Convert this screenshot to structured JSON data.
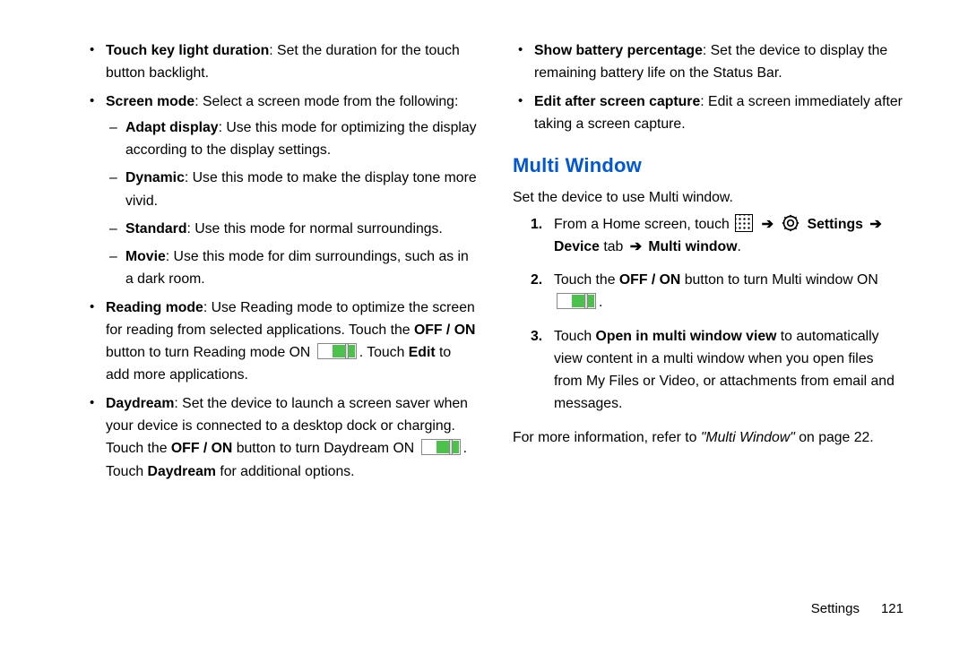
{
  "left": {
    "items": [
      {
        "term": "Touch key light duration",
        "desc": ": Set the duration for the touch button backlight."
      },
      {
        "term": "Screen mode",
        "desc": ": Select a screen mode from the following:",
        "sub": [
          {
            "term": "Adapt display",
            "desc": ": Use this mode for optimizing the display according to the display settings."
          },
          {
            "term": "Dynamic",
            "desc": ": Use this mode to make the display tone more vivid."
          },
          {
            "term": "Standard",
            "desc": ": Use this mode for normal surroundings."
          },
          {
            "term": "Movie",
            "desc": ": Use this mode for dim surroundings, such as in a dark room."
          }
        ]
      },
      {
        "term": "Reading mode",
        "desc_a": ": Use Reading mode to optimize the screen for reading from selected applications. Touch the ",
        "off_on": "OFF / ON",
        "desc_b": " button to turn Reading mode ON ",
        "desc_c": ". Touch ",
        "edit": "Edit",
        "desc_d": " to add more applications."
      },
      {
        "term": "Daydream",
        "desc_a": ": Set the device to launch a screen saver when your device is connected to a desktop dock or charging. Touch the ",
        "off_on": "OFF / ON",
        "desc_b": " button to turn Daydream ON ",
        "desc_c": ". Touch ",
        "dd": "Daydream",
        "desc_d": " for additional options."
      }
    ]
  },
  "right": {
    "top_items": [
      {
        "term": "Show battery percentage",
        "desc": ": Set the device to display the remaining battery life on the Status Bar."
      },
      {
        "term": "Edit after screen capture",
        "desc": ": Edit a screen immediately after taking a screen capture."
      }
    ],
    "heading": "Multi Window",
    "intro": "Set the device to use Multi window.",
    "step1": {
      "a": "From a Home screen, touch ",
      "settings": "Settings",
      "b": " ",
      "device_tab": "Device",
      "c": " tab ",
      "mw": "Multi window",
      "d": "."
    },
    "step2": {
      "a": "Touch the ",
      "off_on": "OFF / ON",
      "b": " button to turn Multi window ON ",
      "c": "."
    },
    "step3": {
      "a": "Touch ",
      "open": "Open in multi window view",
      "b": " to automatically view content in a multi window when you open files from My Files or Video, or attachments from email and messages."
    },
    "tail": {
      "a": "For more information, refer to ",
      "ref": "\"Multi Window\"",
      "b": " on page 22."
    }
  },
  "footer": {
    "section": "Settings",
    "page": "121"
  },
  "arrow": "➔"
}
